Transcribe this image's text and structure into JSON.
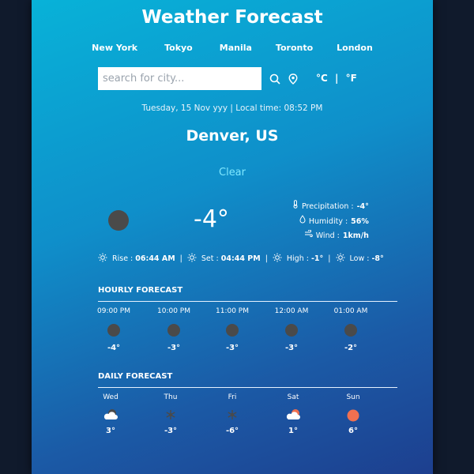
{
  "app": {
    "title": "Weather Forecast"
  },
  "cities": [
    "New York",
    "Tokyo",
    "Manila",
    "Toronto",
    "London"
  ],
  "search": {
    "placeholder": "search for city..."
  },
  "units": {
    "celsius": "°C",
    "separator": "|",
    "fahrenheit": "°F"
  },
  "current": {
    "datetime": "Tuesday, 15 Nov yyy | Local time: 08:52 PM",
    "city": "Denver, US",
    "condition": "Clear",
    "temp": "-4°",
    "precipitation_label": "Precipitation :",
    "precipitation_value": "-4°",
    "humidity_label": "Humidity :",
    "humidity_value": "56%",
    "wind_label": "Wind :",
    "wind_value": "1km/h",
    "rise_label": "Rise :",
    "rise_value": "06:44 AM",
    "set_label": "Set :",
    "set_value": "04:44 PM",
    "high_label": "High :",
    "high_value": "-1°",
    "low_label": "Low :",
    "low_value": "-8°",
    "separator": "|"
  },
  "hourly": {
    "title": "HOURLY FORECAST",
    "items": [
      {
        "time": "09:00 PM",
        "temp": "-4°"
      },
      {
        "time": "10:00 PM",
        "temp": "-3°"
      },
      {
        "time": "11:00 PM",
        "temp": "-3°"
      },
      {
        "time": "12:00 AM",
        "temp": "-3°"
      },
      {
        "time": "01:00 AM",
        "temp": "-2°"
      }
    ]
  },
  "daily": {
    "title": "DAILY FORECAST",
    "items": [
      {
        "day": "Wed",
        "temp": "3°",
        "icon": "partly-cloudy-night-icon"
      },
      {
        "day": "Thu",
        "temp": "-3°",
        "icon": "snow-icon"
      },
      {
        "day": "Fri",
        "temp": "-6°",
        "icon": "snow-icon"
      },
      {
        "day": "Sat",
        "temp": "1°",
        "icon": "partly-cloudy-day-icon"
      },
      {
        "day": "Sun",
        "temp": "6°",
        "icon": "sun-icon"
      }
    ]
  },
  "colors": {
    "accent_condition": "#7fe8ff",
    "sun": "#f07050",
    "dot": "#4a4a4a"
  }
}
